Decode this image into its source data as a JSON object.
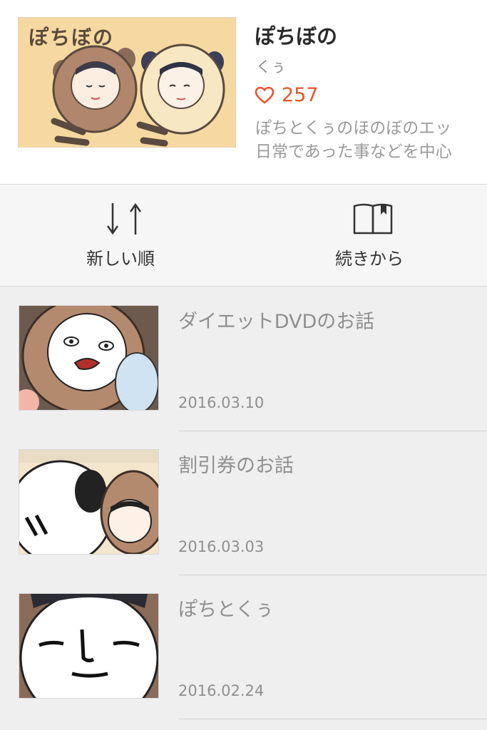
{
  "series": {
    "cover_title": "ぽちぼの",
    "title": "ぽちぼの",
    "author": "くぅ",
    "likes": "257",
    "description_line1": "ぽちとくぅのほのぼのエッ",
    "description_line2": "日常であった事などを中心"
  },
  "toolbar": {
    "sort_label": "新しい順",
    "resume_label": "続きから"
  },
  "episodes": [
    {
      "title": "ダイエットDVDのお話",
      "date": "2016.03.10"
    },
    {
      "title": "割引券のお話",
      "date": "2016.03.03"
    },
    {
      "title": "ぽちとくぅ",
      "date": "2016.02.24"
    }
  ],
  "colors": {
    "accent": "#e8542b",
    "header_bg": "#ffffff",
    "toolbar_bg": "#f6f6f7",
    "list_bg": "#efeff0"
  },
  "icons": {
    "likes": "heart-outline-icon",
    "sort": "sort-arrows-icon",
    "resume": "open-book-icon"
  }
}
